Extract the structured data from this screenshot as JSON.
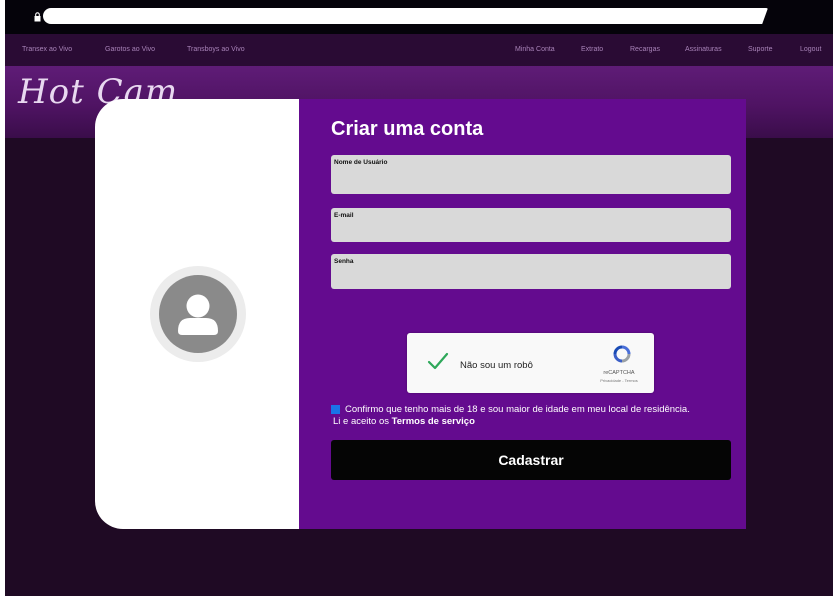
{
  "nav": {
    "left": [
      "Transex ao Vivo",
      "Garotos ao Vivo",
      "Transboys ao Vivo"
    ],
    "right": [
      "Minha Conta",
      "Extrato",
      "Recargas",
      "Assinaturas",
      "Suporte",
      "Logout"
    ]
  },
  "site": {
    "logo": "Hot Cam"
  },
  "form": {
    "title": "Criar uma conta",
    "fields": [
      {
        "label": "Nome de Usuário",
        "value": ""
      },
      {
        "label": "E-mail",
        "value": ""
      },
      {
        "label": "Senha",
        "value": ""
      }
    ],
    "captcha": {
      "label": "Não sou um robô",
      "brand": "reCAPTCHA",
      "links": "Privacidade - Termos"
    },
    "confirm": {
      "text": "Confirmo que tenho mais de 18 e sou maior de idade em meu local de residência. Li e aceito os",
      "link": "Termos de serviço"
    },
    "submit_label": "Cadastrar"
  },
  "colors": {
    "accent": "#640b8f",
    "page_bg": "#1f0a24",
    "button": "#050505",
    "checkbox": "#1a73e8",
    "captcha_check": "#2ea85a"
  },
  "icons": [
    "lock-icon",
    "user-avatar-icon",
    "checkmark-icon",
    "recaptcha-logo-icon"
  ]
}
